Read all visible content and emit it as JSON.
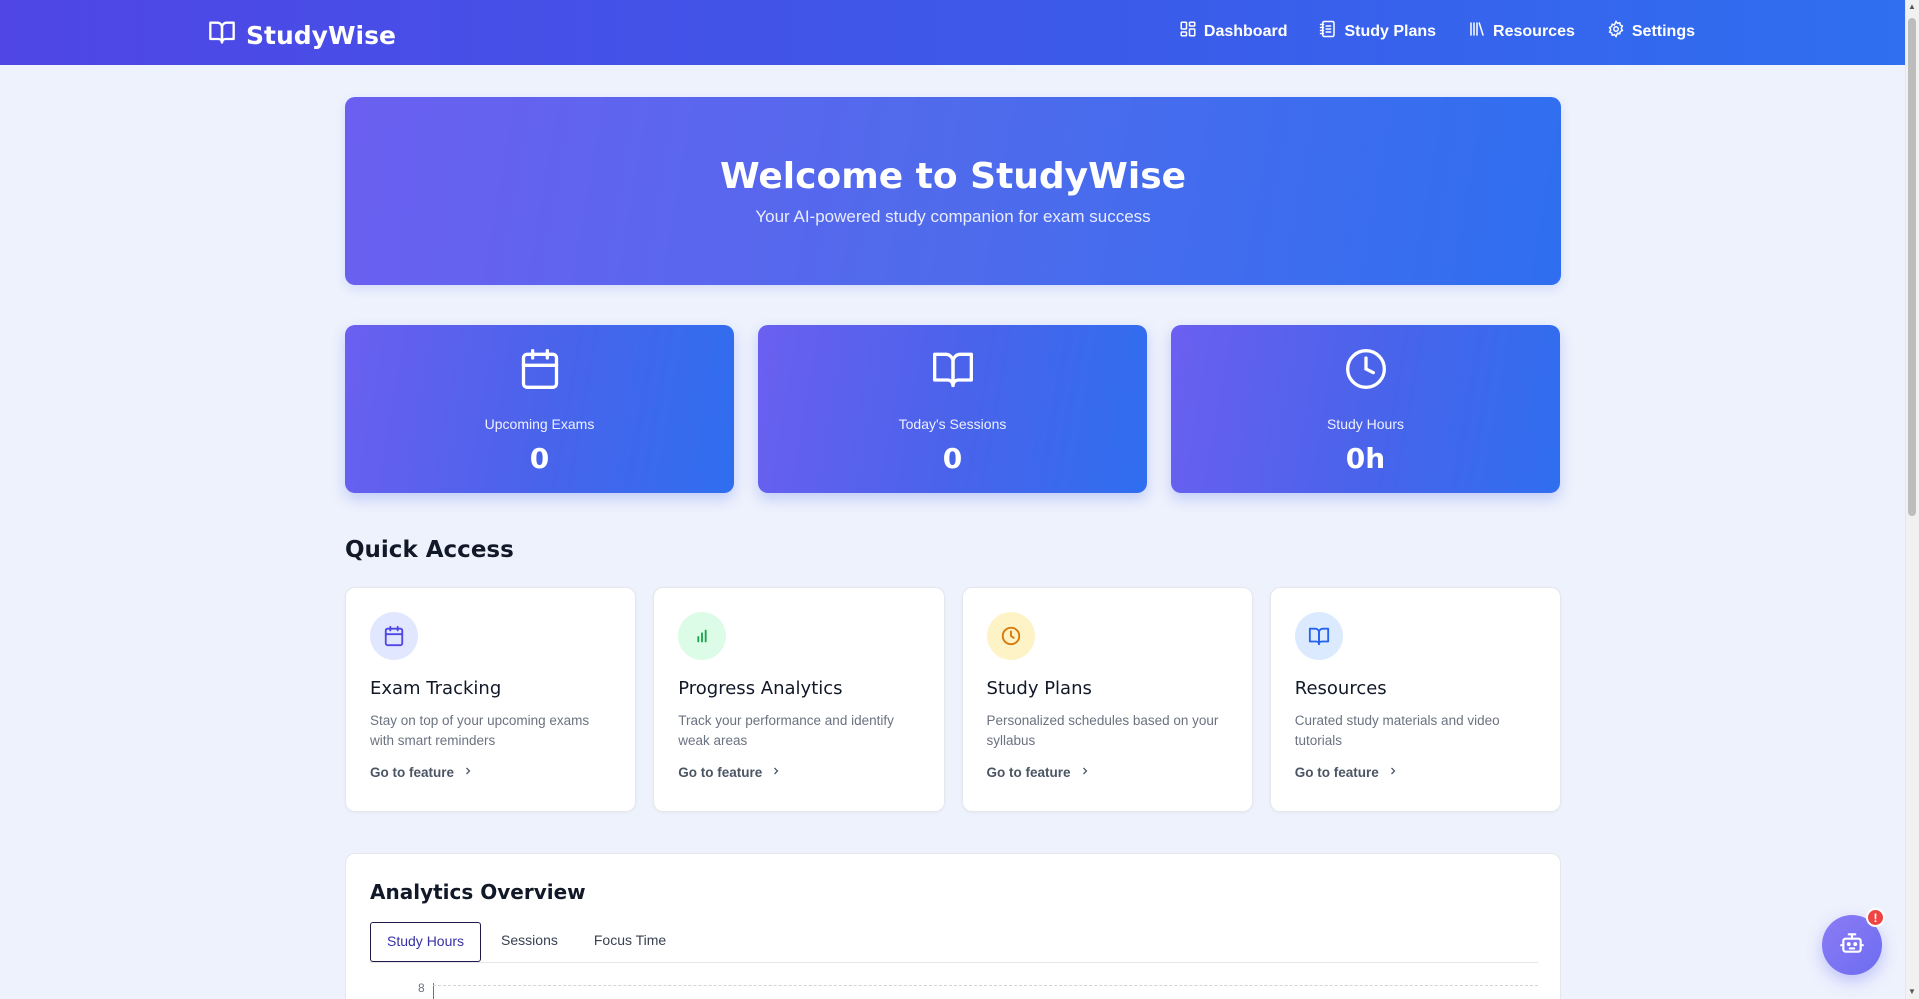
{
  "brand": {
    "name": "StudyWise",
    "icon": "book-open-icon"
  },
  "nav": [
    {
      "label": "Dashboard",
      "icon": "dashboard-grid-icon"
    },
    {
      "label": "Study Plans",
      "icon": "notebook-icon"
    },
    {
      "label": "Resources",
      "icon": "library-icon"
    },
    {
      "label": "Settings",
      "icon": "gear-icon"
    }
  ],
  "hero": {
    "title": "Welcome to StudyWise",
    "subtitle": "Your AI-powered study companion for exam success"
  },
  "stats": [
    {
      "label": "Upcoming Exams",
      "value": "0",
      "icon": "calendar-icon"
    },
    {
      "label": "Today's Sessions",
      "value": "0",
      "icon": "book-open-icon"
    },
    {
      "label": "Study Hours",
      "value": "0h",
      "icon": "clock-icon"
    }
  ],
  "quick_access": {
    "title": "Quick Access",
    "cards": [
      {
        "title": "Exam Tracking",
        "description": "Stay on top of your upcoming exams with smart reminders",
        "link": "Go to feature",
        "icon": "calendar-icon",
        "color": "#4f46e5"
      },
      {
        "title": "Progress Analytics",
        "description": "Track your performance and identify weak areas",
        "link": "Go to feature",
        "icon": "bar-chart-icon",
        "color": "#16a34a"
      },
      {
        "title": "Study Plans",
        "description": "Personalized schedules based on your syllabus",
        "link": "Go to feature",
        "icon": "clock-icon",
        "color": "#d97706"
      },
      {
        "title": "Resources",
        "description": "Curated study materials and video tutorials",
        "link": "Go to feature",
        "icon": "book-open-icon",
        "color": "#2563eb"
      }
    ]
  },
  "analytics": {
    "title": "Analytics Overview",
    "tabs": [
      "Study Hours",
      "Sessions",
      "Focus Time"
    ],
    "active_tab": "Study Hours",
    "y_tick": "8"
  },
  "assistant": {
    "icon": "robot-icon",
    "badge": "!"
  },
  "colors": {
    "primary": "#4f46e5",
    "accent": "#2f6ef0",
    "background": "#eef2fd",
    "badge": "#ef4444"
  }
}
